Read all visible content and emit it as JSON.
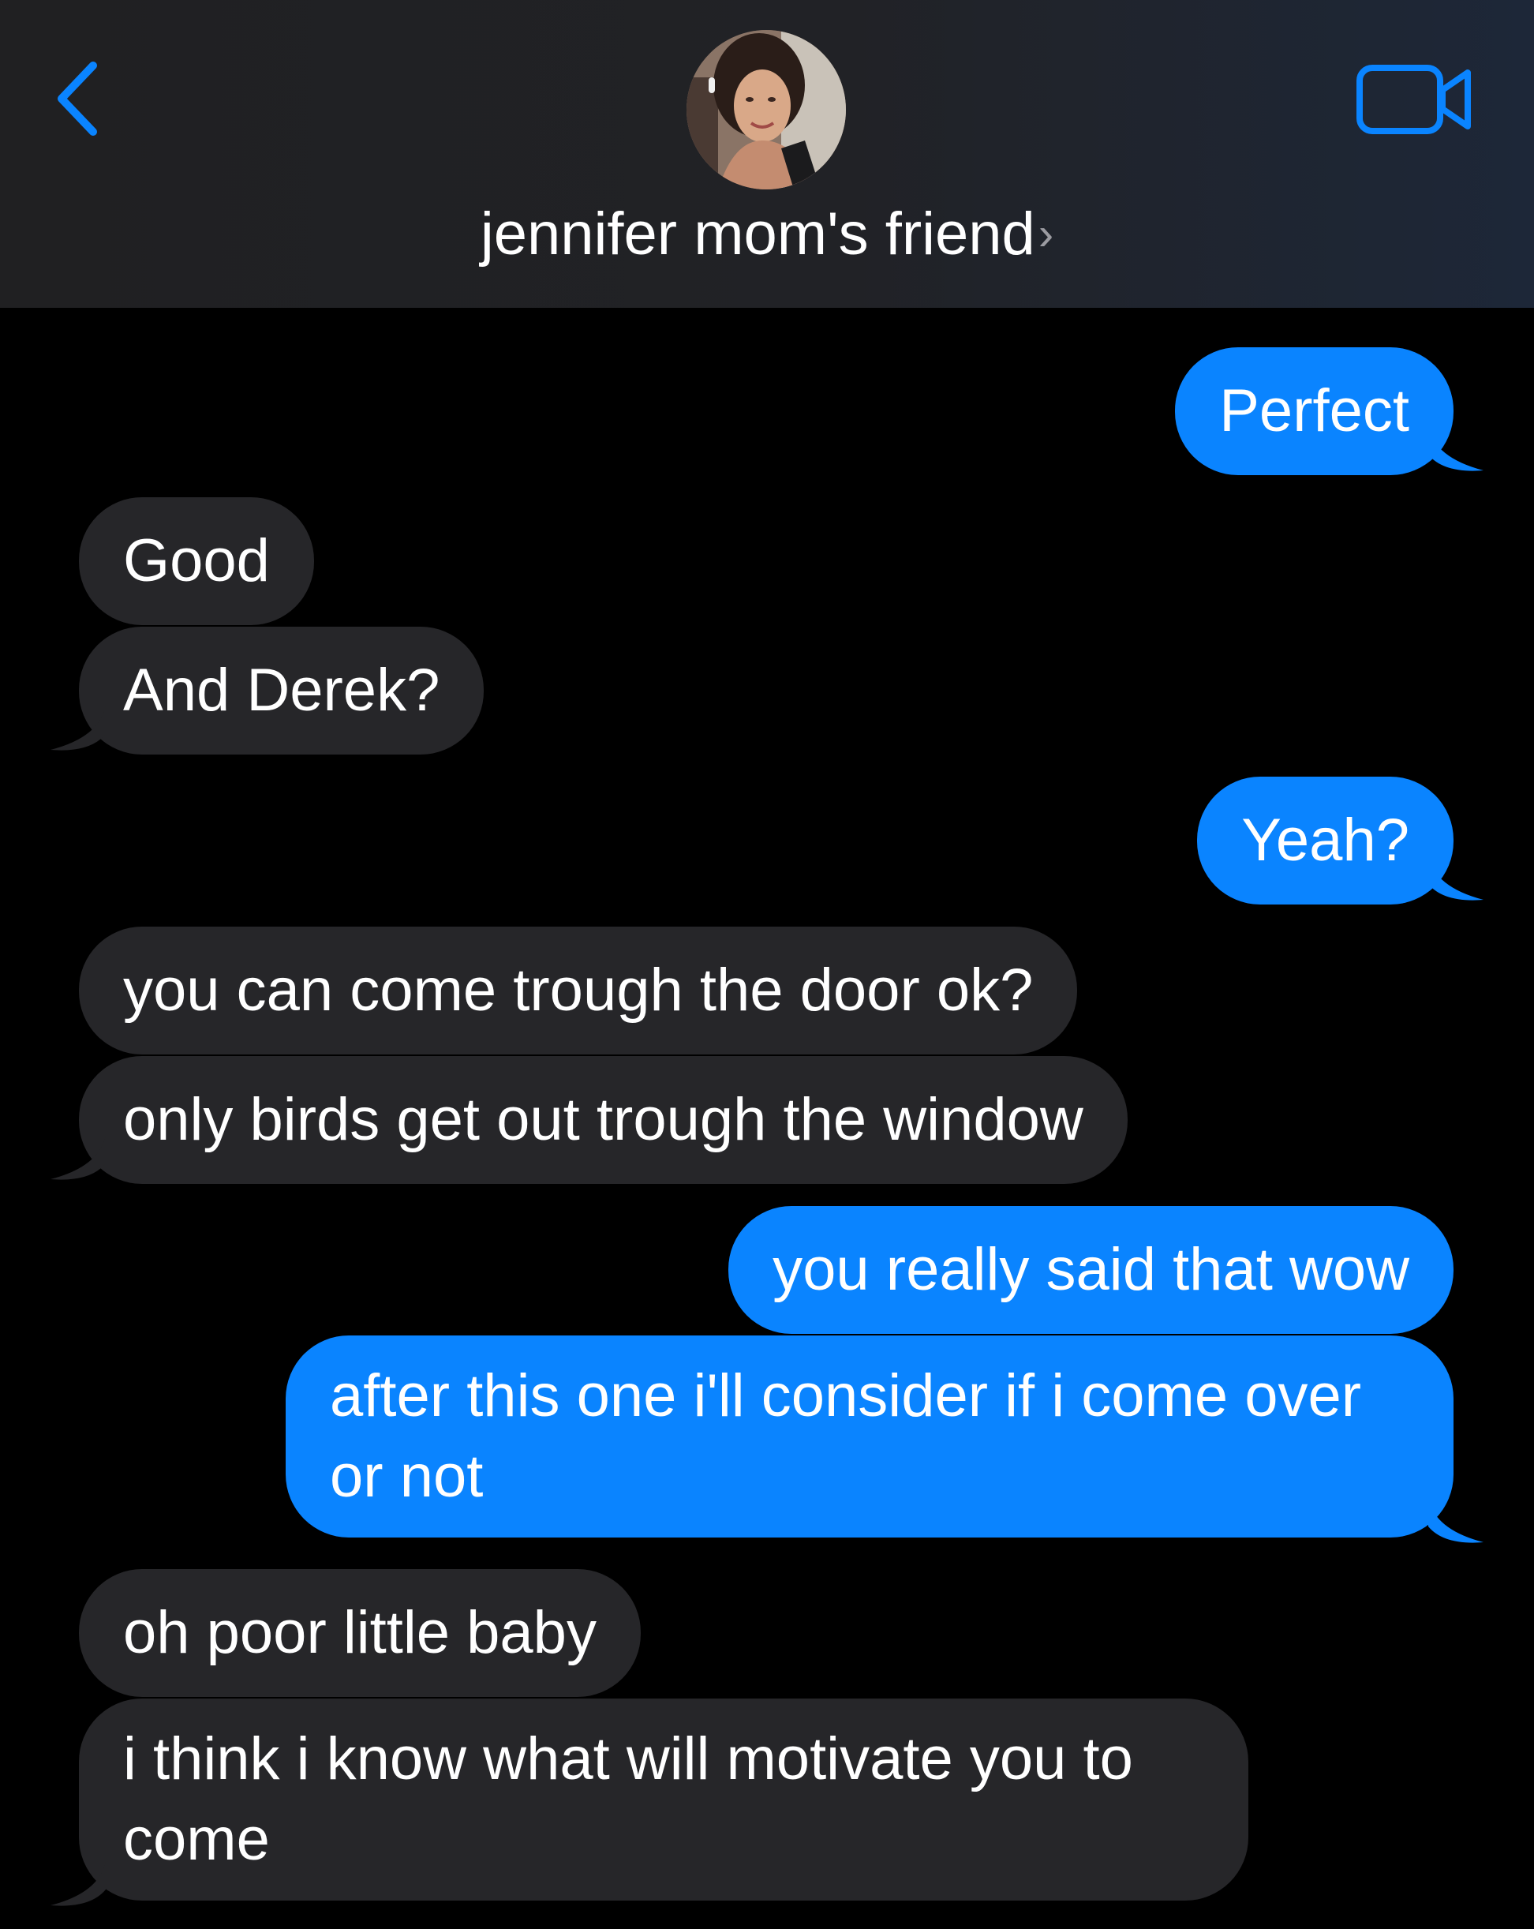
{
  "header": {
    "contact_name": "jennifer mom's friend",
    "chevron": "›",
    "back_icon": "chevron-left-icon",
    "video_icon": "video-camera-icon",
    "accent_color": "#0a84ff"
  },
  "messages": [
    {
      "side": "sent",
      "text": "Perfect"
    },
    {
      "side": "received",
      "text": "Good"
    },
    {
      "side": "received",
      "text": "And Derek?"
    },
    {
      "side": "sent",
      "text": "Yeah?"
    },
    {
      "side": "received",
      "text": "you can come trough the door ok?"
    },
    {
      "side": "received",
      "text": "only birds get out trough the window"
    },
    {
      "side": "sent",
      "text": "you really said that wow"
    },
    {
      "side": "sent",
      "text": "after this one i'll consider if i come over or not"
    },
    {
      "side": "received",
      "text": "oh poor little baby"
    },
    {
      "side": "received",
      "text": "i think i know what will motivate you to come"
    }
  ],
  "colors": {
    "sent_bubble": "#0a84ff",
    "received_bubble": "#262629",
    "background": "#000000"
  }
}
